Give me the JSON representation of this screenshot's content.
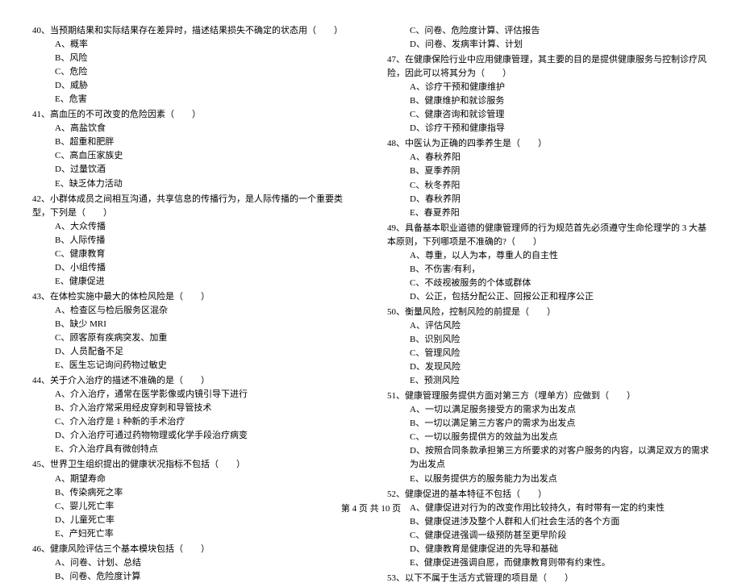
{
  "footer": "第 4 页 共 10 页",
  "left": [
    {
      "stem": "40、当预期结果和实际结果存在差异时，描述结果损失不确定的状态用（　　）",
      "options": [
        "A、概率",
        "B、风险",
        "C、危险",
        "D、威胁",
        "E、危害"
      ]
    },
    {
      "stem": "41、高血压的不可改变的危险因素（　　）",
      "options": [
        "A、高盐饮食",
        "B、超重和肥胖",
        "C、高血压家族史",
        "D、过量饮酒",
        "E、缺乏体力活动"
      ]
    },
    {
      "stem": "42、小群体成员之间相互沟通，共享信息的传播行为，是人际传播的一个重要类型，下列是（　　）",
      "options": [
        "A、大众传播",
        "B、人际传播",
        "C、健康教育",
        "D、小组传播",
        "E、健康促进"
      ]
    },
    {
      "stem": "43、在体检实施中最大的体检风险是（　　）",
      "options": [
        "A、检查区与检后服务区混杂",
        "B、缺少 MRI",
        "C、顾客原有疾病突发、加重",
        "D、人员配备不足",
        "E、医生忘记询问药物过敏史"
      ]
    },
    {
      "stem": "44、关于介入治疗的描述不准确的是（　　）",
      "options": [
        "A、介入治疗，通常在医学影像或内镜引导下进行",
        "B、介入治疗常采用经皮穿刺和导管技术",
        "C、介入治疗是 1 种新的手术治疗",
        "D、介入治疗可通过药物物理或化学手段治疗病变",
        "E、介入治疗具有微创特点"
      ]
    },
    {
      "stem": "45、世界卫生组织提出的健康状况指标不包括（　　）",
      "options": [
        "A、期望寿命",
        "B、传染病死之率",
        "C、婴儿死亡率",
        "D、儿童死亡率",
        "E、产妇死亡率"
      ]
    },
    {
      "stem": "46、健康风险评估三个基本模块包括（　　）",
      "options": [
        "A、问卷、计划、总结",
        "B、问卷、危险度计算"
      ]
    }
  ],
  "right": [
    {
      "stem": "",
      "options": [
        "C、问卷、危险度计算、评估报告",
        "D、问卷、发病率计算、计划"
      ]
    },
    {
      "stem": "47、在健康保险行业中应用健康管理，其主要的目的是提供健康服务与控制诊疗风险，因此可以将其分为（　　）",
      "options": [
        "A、诊疗干预和健康维护",
        "B、健康维护和就诊服务",
        "C、健康咨询和就诊管理",
        "D、诊疗干预和健康指导"
      ]
    },
    {
      "stem": "48、中医认为正确的四季养生是（　　）",
      "options": [
        "A、春秋养阳",
        "B、夏季养阴",
        "C、秋冬养阳",
        "D、春秋养阴",
        "E、春夏养阳"
      ]
    },
    {
      "stem": "49、具备基本职业道德的健康管理师的行为规范首先必须遵守生命伦理学的 3 大基本原则，下列哪项是不准确的?（　　）",
      "options": [
        "A、尊重，以人为本，尊重人的自主性",
        "B、不伤害/有利，",
        "C、不歧视被服务的个体或群体",
        "D、公正，包括分配公正、回报公正和程序公正"
      ]
    },
    {
      "stem": "50、衡量风险，控制风险的前提是（　　）",
      "options": [
        "A、评估风险",
        "B、识别风险",
        "C、管理风险",
        "D、发现风险",
        "E、预测风险"
      ]
    },
    {
      "stem": "51、健康管理服务提供方面对第三方（埋单方）应做到（　　）",
      "options": [
        "A、一切以满足服务接受方的需求为出发点",
        "B、一切以满足第三方客户的需求为出发点",
        "C、一切以服务提供方的效益为出发点",
        "D、按照合同条款承担第三方所要求的对客户服务的内容，以满足双方的需求为出发点",
        "E、以服务提供方的服务能力为出发点"
      ]
    },
    {
      "stem": "52、健康促进的基本特征不包括（　　）",
      "options": [
        "A、健康促进对行为的改变作用比较持久，有时带有一定的约束性",
        "B、健康促进涉及整个人群和人们社会生活的各个方面",
        "C、健康促进强调一级预防甚至更早阶段",
        "D、健康教育是健康促进的先导和基础",
        "E、健康促进强调自愿，而健康教育则带有约束性。"
      ]
    },
    {
      "stem": "53、以下不属于生活方式管理的项目是（　　）",
      "options": []
    }
  ]
}
